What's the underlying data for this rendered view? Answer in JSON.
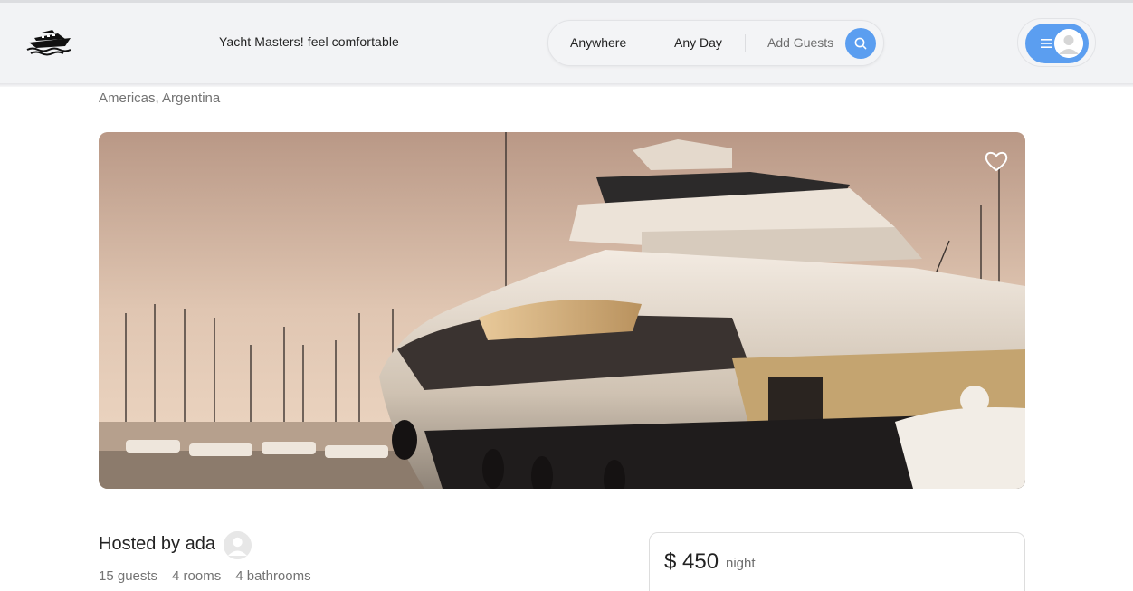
{
  "header": {
    "tagline": "Yacht Masters! feel comfortable",
    "logo_icon": "yacht-logo-icon",
    "search": {
      "location": "Anywhere",
      "date": "Any Day",
      "guests": "Add Guests",
      "search_icon": "search-icon"
    },
    "user_menu": {
      "menu_icon": "hamburger-icon",
      "avatar_icon": "user-avatar-icon"
    }
  },
  "listing": {
    "location": "Americas, Argentina",
    "favorite_icon": "heart-icon",
    "host": {
      "label": "Hosted by ada"
    },
    "facts": {
      "guests": "15 guests",
      "rooms": "4 rooms",
      "bathrooms": "4 bathrooms"
    }
  },
  "reservation": {
    "price": "$ 450",
    "unit": "night"
  },
  "colors": {
    "accent": "#5b9ef0",
    "navbar_bg": "#f2f3f5",
    "muted_text": "#737373"
  }
}
